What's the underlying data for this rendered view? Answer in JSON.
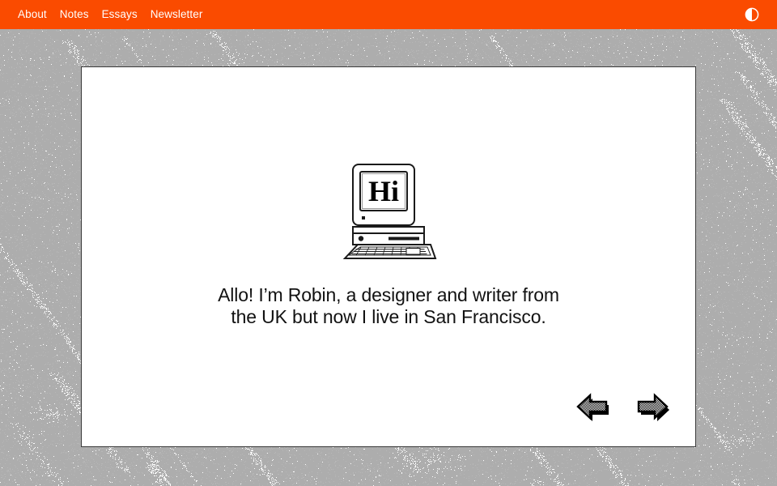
{
  "page": {
    "background_color": "#adadad",
    "texture": "dithered-diagonal-noise"
  },
  "topbar": {
    "background_color": "#fa4b00",
    "text_color": "#ffffff",
    "nav_items": [
      {
        "label": "About",
        "name": "nav-link-about"
      },
      {
        "label": "Notes",
        "name": "nav-link-notes"
      },
      {
        "label": "Essays",
        "name": "nav-link-essays"
      },
      {
        "label": "Newsletter",
        "name": "nav-link-newsletter"
      }
    ],
    "theme_toggle": {
      "icon": "half-circle-contrast-icon",
      "title": "Toggle theme"
    }
  },
  "card": {
    "background_color": "#ffffff",
    "border_color": "#3a3a3a",
    "illustration": {
      "icon": "retro-computer-icon",
      "screen_text": "Hi"
    },
    "intro": {
      "line1": "Allo! I’m Robin, a designer and writer from",
      "line2": "the UK but now I live in San Francisco.",
      "text_color": "#121212"
    },
    "pager": {
      "prev": {
        "icon": "arrow-left-icon",
        "title": "Previous"
      },
      "next": {
        "icon": "arrow-right-icon",
        "title": "Next"
      }
    }
  }
}
